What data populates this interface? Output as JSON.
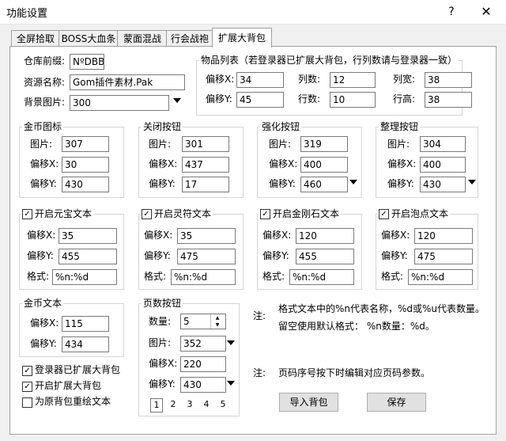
{
  "window": {
    "title": "功能设置",
    "help": "?",
    "close": "✕"
  },
  "tabs": [
    "全屏拾取",
    "BOSS大血条",
    "蒙面混战",
    "行会战袍",
    "扩展大背包"
  ],
  "general": {
    "prefix_label": "仓库前缀:",
    "prefix_value": "NºDBB",
    "resource_label": "资源名称:",
    "resource_value": "Gom插件素材.Pak",
    "bg_label": "背景图片:",
    "bg_value": "300"
  },
  "item_list": {
    "title": "物品列表（若登录器已扩展大背包，行列数请与登录器一致）",
    "offset_x_label": "偏移X:",
    "offset_x": "34",
    "offset_y_label": "偏移Y:",
    "offset_y": "45",
    "cols_label": "列数:",
    "cols": "12",
    "rows_label": "行数:",
    "rows": "10",
    "col_width_label": "列宽:",
    "col_width": "38",
    "row_height_label": "行高:",
    "row_height": "38"
  },
  "labels": {
    "pic": "图片:",
    "ox": "偏移X:",
    "oy": "偏移Y:",
    "fmt": "格式:",
    "count": "数量:"
  },
  "gold_icon": {
    "title": "金币图标",
    "pic": "307",
    "ox": "30",
    "oy": "430"
  },
  "close_btn": {
    "title": "关闭按钮",
    "pic": "301",
    "ox": "437",
    "oy": "17"
  },
  "strengthen_btn": {
    "title": "强化按钮",
    "pic": "319",
    "ox": "400",
    "oy": "460"
  },
  "tidy_btn": {
    "title": "整理按钮",
    "pic": "304",
    "ox": "400",
    "oy": "430"
  },
  "yuanbao_text": {
    "title": "开启元宝文本",
    "ox": "35",
    "oy": "455",
    "fmt": "%n:%d"
  },
  "lingfu_text": {
    "title": "开启灵符文本",
    "ox": "35",
    "oy": "475",
    "fmt": "%n:%d"
  },
  "jingang_text": {
    "title": "开启金刚石文本",
    "ox": "120",
    "oy": "455",
    "fmt": "%n:%d"
  },
  "paodian_text": {
    "title": "开启泡点文本",
    "ox": "120",
    "oy": "475",
    "fmt": "%n:%d"
  },
  "gold_text": {
    "title": "金币文本",
    "ox": "115",
    "oy": "434"
  },
  "page_btn": {
    "title": "页数按钮",
    "count": "5",
    "pic": "352",
    "ox": "220",
    "oy": "430",
    "pages": [
      "1",
      "2",
      "3",
      "4",
      "5"
    ]
  },
  "notes": {
    "prefix": "注:",
    "line1": "格式文本中的%n代表名称，%d或%u代表数量。",
    "line2": "留空使用默认格式： %n数量：%d。",
    "line3": "页码序号按下时编辑对应页码参数。"
  },
  "options": {
    "login_extended": "登录器已扩展大背包",
    "enable_extended": "开启扩展大背包",
    "redraw_text": "为原背包重绘文本"
  },
  "buttons": {
    "import": "导入背包",
    "save": "保存"
  }
}
